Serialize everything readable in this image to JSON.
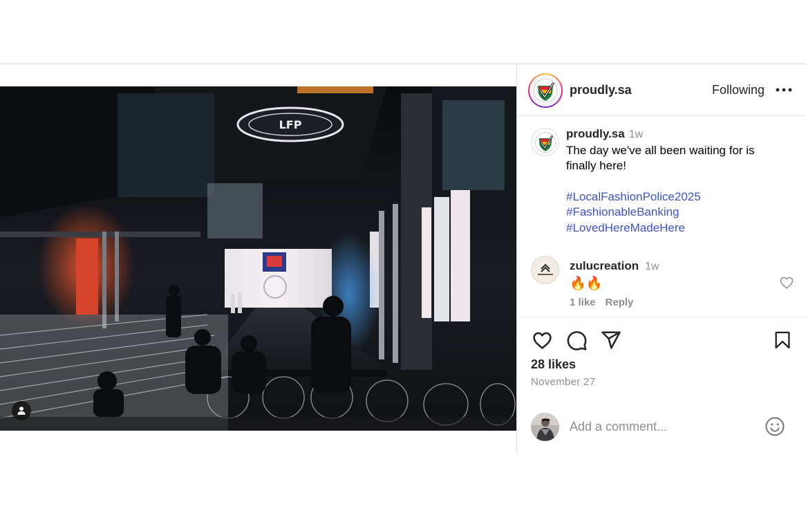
{
  "post": {
    "username": "proudly.sa",
    "follow_status": "Following",
    "more_options_icon": "more-horizontal-icon",
    "caption": {
      "username": "proudly.sa",
      "time": "1w",
      "text": "The day we've all been waiting for is finally here!",
      "hashtags": [
        "#LocalFashionPolice2025",
        "#FashionableBanking",
        "#LovedHereMadeHere"
      ]
    },
    "comments": [
      {
        "username": "zulucreation",
        "time": "1w",
        "text": "🔥🔥",
        "likes_label": "1 like",
        "reply_label": "Reply"
      }
    ],
    "likes_label": "28 likes",
    "date": "November 27",
    "composer": {
      "placeholder": "Add a comment..."
    }
  },
  "icons": {
    "like": "heart-icon",
    "comment": "comment-bubble-icon",
    "share": "paper-plane-icon",
    "save": "bookmark-icon",
    "emoji": "smiley-icon",
    "tag": "user-tag-icon"
  },
  "colors": {
    "hashtag": "#3e53c7",
    "muted": "#8e8e8e",
    "border": "#dbdbdb",
    "text": "#262626"
  }
}
